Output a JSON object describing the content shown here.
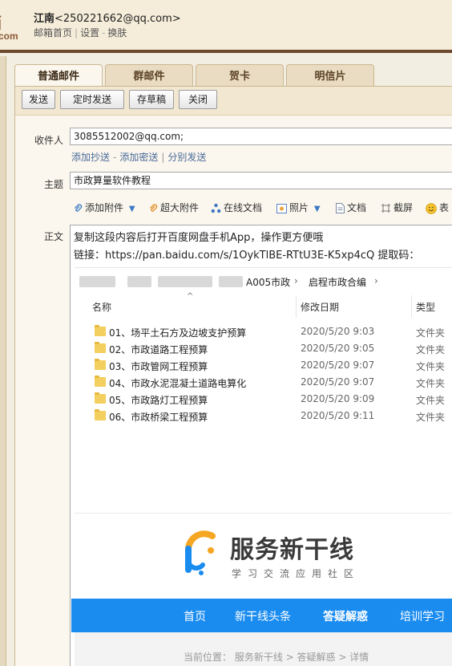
{
  "header": {
    "logo_big": "箱",
    "logo_small": "com",
    "user_name": "江南",
    "user_email": "<250221662@qq.com>",
    "links": [
      "邮箱首页",
      "设置",
      "换肤"
    ]
  },
  "tabs": [
    {
      "label": "普通邮件",
      "active": true
    },
    {
      "label": "群邮件",
      "active": false
    },
    {
      "label": "贺卡",
      "active": false
    },
    {
      "label": "明信片",
      "active": false
    }
  ],
  "toolbar": {
    "send": "发送",
    "schedule": "定时发送",
    "draft": "存草稿",
    "close": "关闭"
  },
  "compose": {
    "to_label": "收件人",
    "to_value": "3085512002@qq.com;",
    "add_cc": "添加抄送",
    "add_bcc": "添加密送",
    "separate_send": "分别发送",
    "subject_label": "主题",
    "subject_value": "市政算量软件教程",
    "body_label": "正文",
    "attach": {
      "add_attachment": "添加附件",
      "large_attachment": "超大附件",
      "online_doc": "在线文档",
      "photo": "照片",
      "document": "文档",
      "screenshot": "截屏",
      "emoji": "表"
    }
  },
  "body": {
    "line1": "复制这段内容后打开百度网盘手机App，操作更方便哦",
    "line2": "链接：https://pan.baidu.com/s/1OykTlBE-RTtU3E-K5xp4cQ 提取码："
  },
  "explorer": {
    "breadcrumb": [
      "A005市政",
      "启程市政合编"
    ],
    "columns": {
      "name": "名称",
      "date": "修改日期",
      "type": "类型"
    },
    "rows": [
      {
        "name": "01、场平土石方及边坡支护预算",
        "date": "2020/5/20 9:03",
        "type": "文件夹"
      },
      {
        "name": "02、市政道路工程预算",
        "date": "2020/5/20 9:05",
        "type": "文件夹"
      },
      {
        "name": "03、市政管网工程预算",
        "date": "2020/5/20 9:07",
        "type": "文件夹"
      },
      {
        "name": "04、市政水泥混凝土道路电算化",
        "date": "2020/5/20 9:07",
        "type": "文件夹"
      },
      {
        "name": "05、市政路灯工程预算",
        "date": "2020/5/20 9:09",
        "type": "文件夹"
      },
      {
        "name": "06、市政桥梁工程预算",
        "date": "2020/5/20 9:11",
        "type": "文件夹"
      }
    ]
  },
  "site": {
    "title": "服务新干线",
    "subtitle": "学习交流应用社区",
    "nav": [
      "首页",
      "新干线头条",
      "答疑解惑",
      "培训学习"
    ],
    "breadcrumb": "当前位置： 服务新干线 > 答疑解惑 > 详情",
    "colors": {
      "nav_bg": "#1a8cf0",
      "logo_orange": "#f5a623",
      "logo_blue": "#1a8cf0"
    }
  }
}
